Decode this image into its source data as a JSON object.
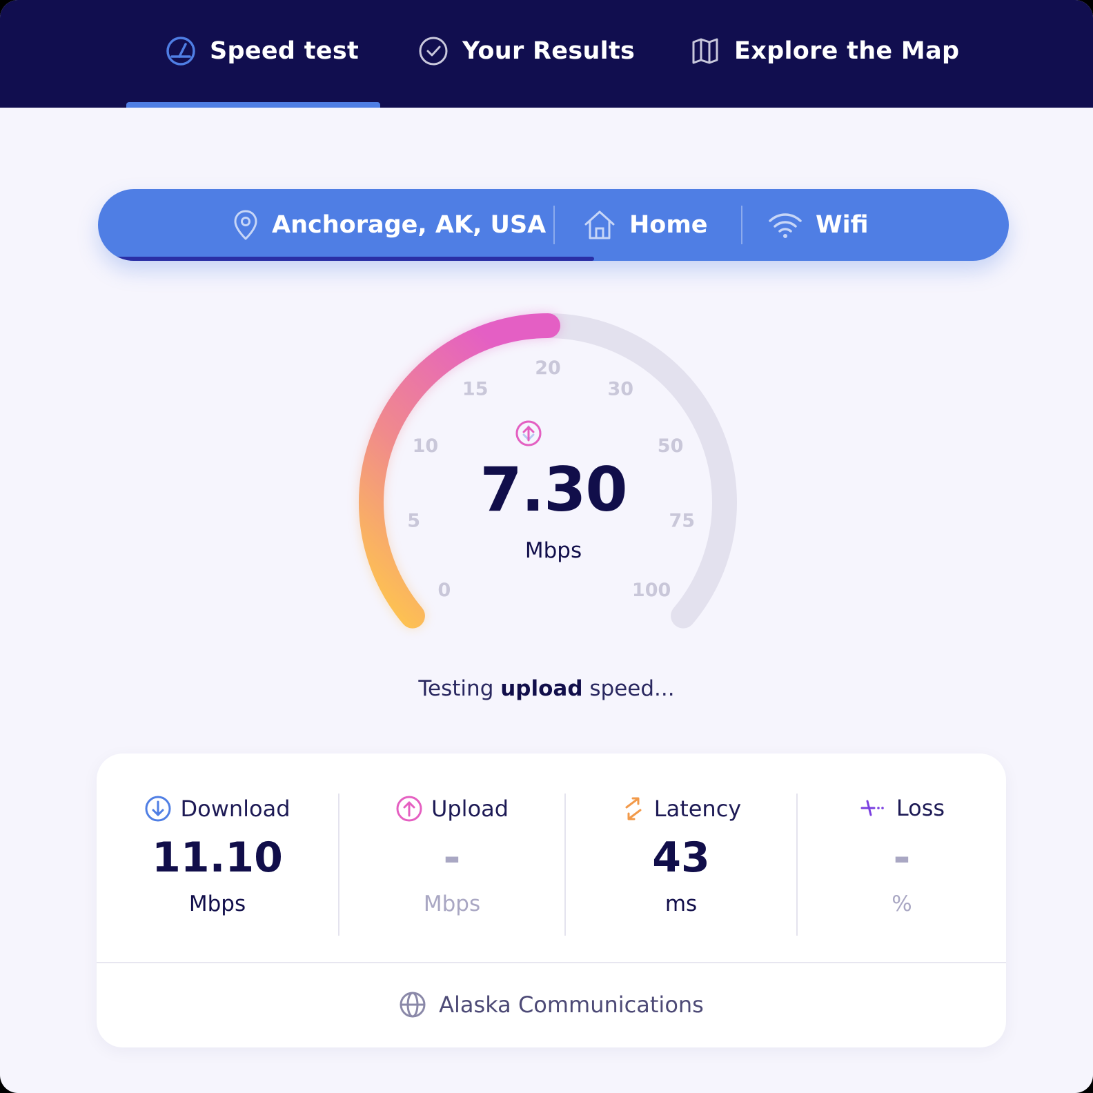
{
  "nav": {
    "tabs": [
      {
        "label": "Speed test",
        "icon": "speedometer-icon",
        "active": true
      },
      {
        "label": "Your Results",
        "icon": "check-circle-icon",
        "active": false
      },
      {
        "label": "Explore the Map",
        "icon": "map-icon",
        "active": false
      }
    ]
  },
  "connection": {
    "location": "Anchorage, AK, USA",
    "place": "Home",
    "network": "Wifi",
    "progress": 0.545
  },
  "gauge": {
    "ticks": [
      "0",
      "5",
      "10",
      "15",
      "20",
      "30",
      "50",
      "75",
      "100"
    ],
    "value": "7.30",
    "unit": "Mbps",
    "fill_fraction": 0.5,
    "active_direction": "upload"
  },
  "status": {
    "prefix": "Testing",
    "emphasis": "upload",
    "suffix": "speed..."
  },
  "results": {
    "download": {
      "label": "Download",
      "value": "11.10",
      "unit": "Mbps"
    },
    "upload": {
      "label": "Upload",
      "value": "-",
      "unit": "Mbps"
    },
    "latency": {
      "label": "Latency",
      "value": "43",
      "unit": "ms"
    },
    "loss": {
      "label": "Loss",
      "value": "-",
      "unit": "%"
    }
  },
  "provider": {
    "name": "Alaska Communications"
  },
  "colors": {
    "nav_bg": "#110e4f",
    "accent_blue": "#4f7ee4",
    "upload_pink": "#e55fc1",
    "download_blue": "#4f7ee4",
    "latency_orange": "#f29a4a",
    "loss_purple": "#7a3fe0",
    "gauge_track": "#e3e1ee",
    "gauge_start": "#ffc94a",
    "gauge_end": "#e45fc4"
  }
}
